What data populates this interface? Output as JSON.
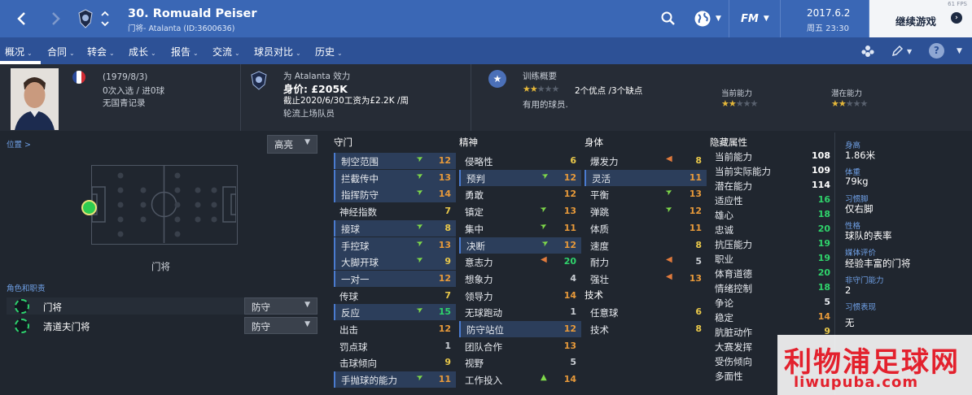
{
  "topbar": {
    "title": "30. Romuald Peiser",
    "subtitle": "门将- Atalanta (ID:3600636)",
    "logo_icon": "fm-logo-icon",
    "logo_text": "FM",
    "date": "2017.6.2",
    "time": "周五 23:30",
    "continue_label": "继续游戏",
    "fps": "61 FPS"
  },
  "menu": {
    "items": [
      "概况",
      "合同",
      "转会",
      "成长",
      "报告",
      "交流",
      "球员对比",
      "历史"
    ]
  },
  "header": {
    "birth": "(1979/8/3)",
    "caps": "0次入选 / 进0球",
    "youth": "无国青记录",
    "club_label": "为 Atalanta 效力",
    "value": "身价: £205K",
    "contract": "截止2020/6/30工资为£2.2K /周",
    "squad": "轮流上场队员",
    "training_title": "训练概要",
    "traits": "2个优点 /3个缺点",
    "useful": "有用的球员.",
    "current_ability_label": "当前能力",
    "potential_ability_label": "潜在能力",
    "stars_training": 2,
    "stars_current": 2,
    "stars_potential": 2,
    "flag_colors": [
      "#2a4a9c",
      "#ffffff",
      "#d12a33"
    ]
  },
  "left": {
    "position_link": "位置 >",
    "highlight": "高亮",
    "position_name": "门将",
    "roles_heading": "角色和职责",
    "roles": [
      {
        "name": "门将",
        "duty": "防守"
      },
      {
        "name": "清道夫门将",
        "duty": "防守"
      }
    ]
  },
  "categories": {
    "defending": "守门",
    "mental": "精神",
    "physical": "身体",
    "technical": "技术",
    "hidden": "隐藏属性"
  },
  "gk_attrs": [
    {
      "name": "制空范围",
      "value": "12",
      "trend": "up",
      "hl": true
    },
    {
      "name": "拦截传中",
      "value": "13",
      "trend": "up",
      "hl": true
    },
    {
      "name": "指挥防守",
      "value": "14",
      "trend": "up",
      "hl": true
    },
    {
      "name": "神经指数",
      "value": "7",
      "trend": "",
      "hl": false
    },
    {
      "name": "接球",
      "value": "8",
      "trend": "up",
      "hl": true
    },
    {
      "name": "手控球",
      "value": "13",
      "trend": "up",
      "hl": true
    },
    {
      "name": "大脚开球",
      "value": "9",
      "trend": "up",
      "hl": true
    },
    {
      "name": "一对一",
      "value": "12",
      "trend": "",
      "hl": true
    },
    {
      "name": "传球",
      "value": "7",
      "trend": "",
      "hl": false
    },
    {
      "name": "反应",
      "value": "15",
      "trend": "up",
      "hl": true
    },
    {
      "name": "出击",
      "value": "12",
      "trend": "",
      "hl": false
    },
    {
      "name": "罚点球",
      "value": "1",
      "trend": "",
      "hl": false
    },
    {
      "name": "击球倾向",
      "value": "9",
      "trend": "",
      "hl": false
    },
    {
      "name": "手抛球的能力",
      "value": "11",
      "trend": "up",
      "hl": true
    }
  ],
  "mental_attrs": [
    {
      "name": "侵略性",
      "value": "6",
      "trend": "",
      "hl": false
    },
    {
      "name": "预判",
      "value": "12",
      "trend": "up",
      "hl": true
    },
    {
      "name": "勇敢",
      "value": "12",
      "trend": "",
      "hl": false
    },
    {
      "name": "镇定",
      "value": "13",
      "trend": "up",
      "hl": false
    },
    {
      "name": "集中",
      "value": "11",
      "trend": "up",
      "hl": false
    },
    {
      "name": "决断",
      "value": "12",
      "trend": "up",
      "hl": true
    },
    {
      "name": "意志力",
      "value": "20",
      "trend": "down",
      "hl": false
    },
    {
      "name": "想象力",
      "value": "4",
      "trend": "",
      "hl": false
    },
    {
      "name": "领导力",
      "value": "14",
      "trend": "",
      "hl": false
    },
    {
      "name": "无球跑动",
      "value": "1",
      "trend": "",
      "hl": false
    },
    {
      "name": "防守站位",
      "value": "12",
      "trend": "",
      "hl": true
    },
    {
      "name": "团队合作",
      "value": "13",
      "trend": "",
      "hl": false
    },
    {
      "name": "视野",
      "value": "5",
      "trend": "",
      "hl": false
    },
    {
      "name": "工作投入",
      "value": "14",
      "trend": "upg",
      "hl": false
    }
  ],
  "physical_attrs": [
    {
      "name": "爆发力",
      "value": "8",
      "trend": "down",
      "hl": false
    },
    {
      "name": "灵活",
      "value": "11",
      "trend": "",
      "hl": true
    },
    {
      "name": "平衡",
      "value": "13",
      "trend": "up",
      "hl": false
    },
    {
      "name": "弹跳",
      "value": "12",
      "trend": "up",
      "hl": false
    },
    {
      "name": "体质",
      "value": "11",
      "trend": "",
      "hl": false
    },
    {
      "name": "速度",
      "value": "8",
      "trend": "",
      "hl": false
    },
    {
      "name": "耐力",
      "value": "5",
      "trend": "down",
      "hl": false
    },
    {
      "name": "强壮",
      "value": "13",
      "trend": "down",
      "hl": false
    }
  ],
  "technical_attrs": [
    {
      "name": "任意球",
      "value": "6",
      "trend": "",
      "hl": false
    },
    {
      "name": "技术",
      "value": "8",
      "trend": "",
      "hl": false
    }
  ],
  "hidden_attrs": [
    {
      "name": "当前能力",
      "value": "108",
      "color": "#ffffff"
    },
    {
      "name": "当前实际能力",
      "value": "109",
      "color": "#ffffff"
    },
    {
      "name": "潜在能力",
      "value": "114",
      "color": "#ffffff"
    },
    {
      "name": "适应性",
      "value": "16",
      "color": "#2fd26b"
    },
    {
      "name": "雄心",
      "value": "18",
      "color": "#2fd26b"
    },
    {
      "name": "忠诚",
      "value": "20",
      "color": "#2fd26b"
    },
    {
      "name": "抗压能力",
      "value": "19",
      "color": "#2fd26b"
    },
    {
      "name": "职业",
      "value": "19",
      "color": "#2fd26b"
    },
    {
      "name": "体育道德",
      "value": "20",
      "color": "#2fd26b"
    },
    {
      "name": "情绪控制",
      "value": "18",
      "color": "#2fd26b"
    },
    {
      "name": "争论",
      "value": "5",
      "color": "#e6e9ee"
    },
    {
      "name": "稳定",
      "value": "14",
      "color": "#e89a3a"
    },
    {
      "name": "肮脏动作",
      "value": "9",
      "color": "#e9c84a"
    },
    {
      "name": "大赛发挥",
      "value": "",
      "color": "#e6e9ee"
    },
    {
      "name": "受伤倾向",
      "value": "",
      "color": "#e6e9ee"
    },
    {
      "name": "多面性",
      "value": "",
      "color": "#e6e9ee"
    }
  ],
  "info": {
    "height_label": "身高",
    "height": "1.86米",
    "weight_label": "体重",
    "weight": "79kg",
    "foot_label": "习惯脚",
    "foot": "仅右脚",
    "personality_label": "性格",
    "personality": "球队的表率",
    "media_label": "媒体评价",
    "media": "经验丰富的门将",
    "nongk_label": "非守门能力",
    "nongk": "2",
    "habits_label": "习惯表现",
    "habits": "无"
  },
  "watermark": {
    "title": "利物浦足球网",
    "url": "liwupuba.com"
  }
}
